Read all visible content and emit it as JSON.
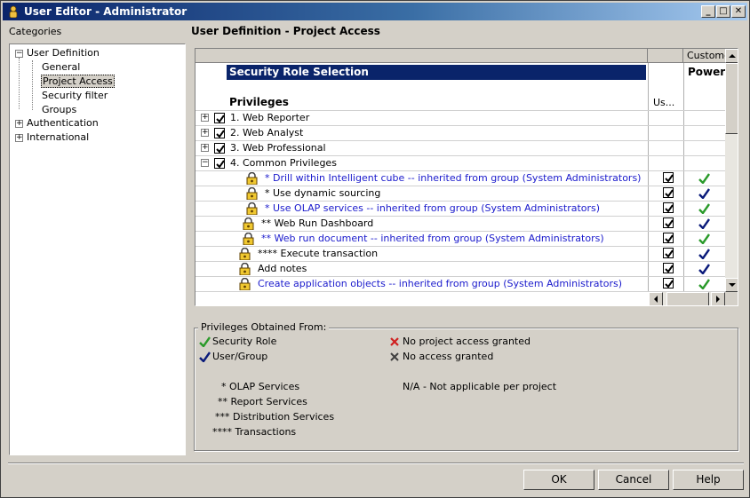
{
  "window": {
    "title": "User Editor - Administrator"
  },
  "categories": {
    "label": "Categories",
    "tree": [
      {
        "label": "User Definition",
        "expanded": true,
        "children": [
          "General",
          "Project Access",
          "Security filter",
          "Groups"
        ],
        "selected_child": "Project Access"
      },
      {
        "label": "Authentication",
        "expanded": false
      },
      {
        "label": "International",
        "expanded": false
      }
    ]
  },
  "panel": {
    "title": "User Definition - Project Access"
  },
  "grid": {
    "column_header_customer": "Custome",
    "security_role_label": "Security Role Selection",
    "security_role_value": "Power",
    "privileges_header": "Privileges",
    "user_column_header": "Us...",
    "groups": [
      {
        "label": "1. Web Reporter",
        "expanded": false,
        "checked": true
      },
      {
        "label": "2. Web Analyst",
        "expanded": false,
        "checked": true
      },
      {
        "label": "3. Web Professional",
        "expanded": false,
        "checked": true
      },
      {
        "label": "4. Common Privileges",
        "expanded": true,
        "checked": true
      }
    ],
    "privileges": [
      {
        "label": "* Drill within Intelligent cube -- inherited from group (System Administrators)",
        "inherited": true,
        "user_checked": true,
        "source": "security-role"
      },
      {
        "label": "* Use dynamic sourcing",
        "inherited": false,
        "user_checked": true,
        "source": "user-group"
      },
      {
        "label": "* Use OLAP services -- inherited from group (System Administrators)",
        "inherited": true,
        "user_checked": true,
        "source": "security-role"
      },
      {
        "label": "** Web Run Dashboard",
        "inherited": false,
        "user_checked": true,
        "source": "user-group"
      },
      {
        "label": "** Web run document -- inherited from group (System Administrators)",
        "inherited": true,
        "user_checked": true,
        "source": "security-role"
      },
      {
        "label": "**** Execute transaction",
        "inherited": false,
        "user_checked": true,
        "source": "user-group"
      },
      {
        "label": "Add notes",
        "inherited": false,
        "user_checked": true,
        "source": "user-group"
      },
      {
        "label": "Create application objects -- inherited from group (System Administrators)",
        "inherited": true,
        "user_checked": true,
        "source": "security-role"
      }
    ]
  },
  "legend": {
    "title": "Privileges Obtained From:",
    "security_role": "Security Role",
    "user_group": "User/Group",
    "no_project_access": "No project access granted",
    "no_access": "No access granted",
    "olap": "* OLAP Services",
    "report": "** Report Services",
    "distribution": "*** Distribution Services",
    "transactions": "**** Transactions",
    "na": "N/A - Not applicable per project"
  },
  "buttons": {
    "ok": "OK",
    "cancel": "Cancel",
    "help": "Help"
  },
  "colors": {
    "security_role_check": "#2a9a2a",
    "user_group_check": "#0a1a7a",
    "inherited_text": "#1a1acc",
    "selection_bar": "#0a246a"
  }
}
